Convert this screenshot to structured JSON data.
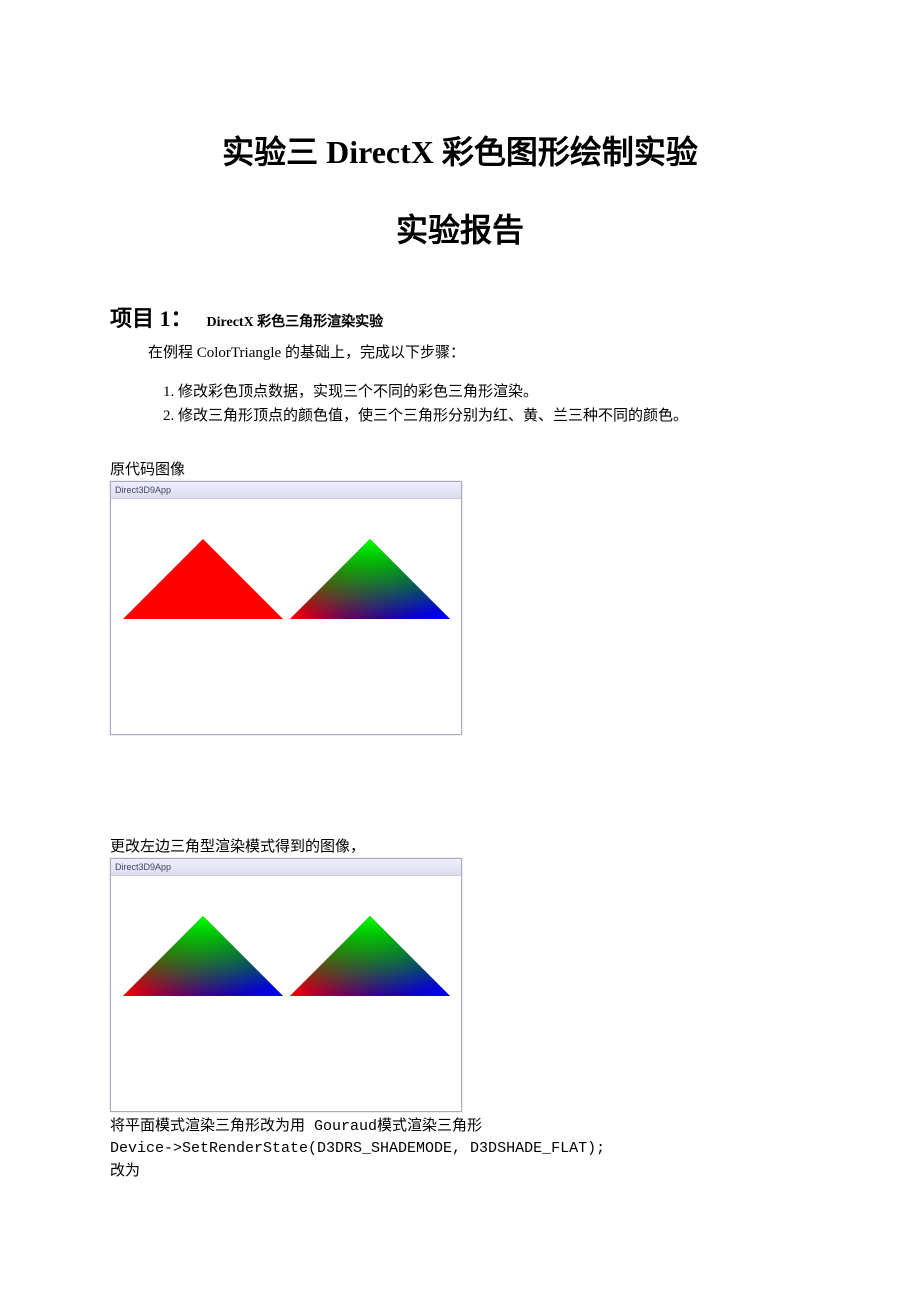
{
  "title_main": "实验三  DirectX 彩色图形绘制实验",
  "title_sub": "实验报告",
  "project": {
    "label": "项目 1：",
    "desc": "DirectX 彩色三角形渲染实验"
  },
  "intro": "在例程 ColorTriangle 的基础上，完成以下步骤：",
  "steps": [
    "修改彩色顶点数据，实现三个不同的彩色三角形渲染。",
    "修改三角形顶点的颜色值，使三个三角形分别为红、黄、兰三种不同的颜色。"
  ],
  "figures": {
    "fig1_caption": "原代码图像",
    "fig2_caption": "更改左边三角型渲染模式得到的图像，",
    "window_title": "Direct3D9App"
  },
  "code_text": {
    "line1": "将平面模式渲染三角形改为用 Gouraud模式渲染三角形",
    "line2": "Device->SetRenderState(D3DRS_SHADEMODE, D3DSHADE_FLAT);",
    "line3": "改为"
  }
}
